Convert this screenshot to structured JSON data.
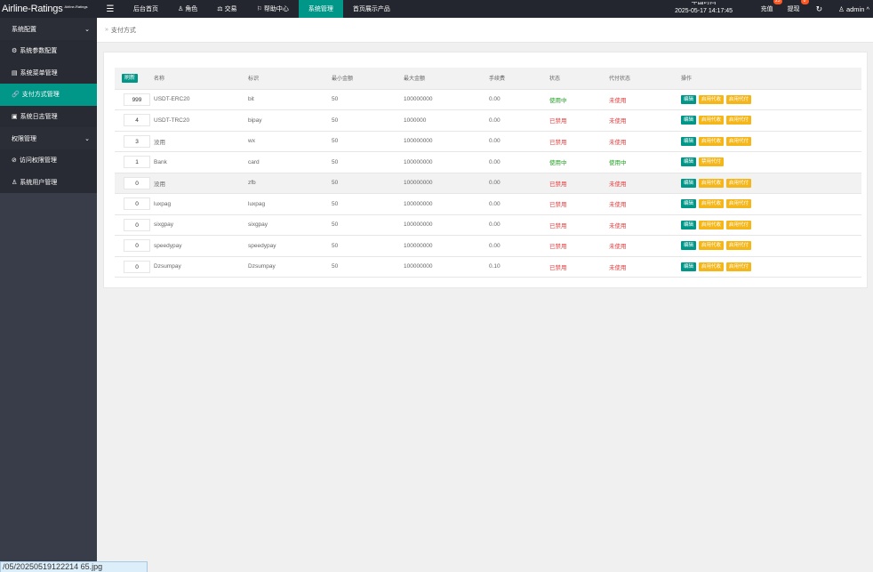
{
  "header": {
    "logo": "Airline-Ratings",
    "logo_sub": "Airline-Ratings",
    "menu_icon": "hamburger-icon",
    "nav": [
      {
        "label": "后台首页",
        "icon": ""
      },
      {
        "label": "角色",
        "icon": "user-icon"
      },
      {
        "label": "交易",
        "icon": "scale-icon"
      },
      {
        "label": "帮助中心",
        "icon": "flag-icon"
      },
      {
        "label": "系统管理",
        "icon": "",
        "active": true
      },
      {
        "label": "首页展示产品",
        "icon": ""
      }
    ],
    "time_label": "中国时间",
    "time_value": "2025-05-17 14:17:45",
    "recharge_label": "充值",
    "recharge_badge": "23",
    "withdraw_label": "提现",
    "withdraw_badge": "0",
    "admin_label": "admin",
    "accent": "#009688"
  },
  "sidebar": {
    "groups": [
      {
        "label": "系统配置",
        "items": [
          {
            "label": "系统参数配置",
            "icon": "gear-icon"
          },
          {
            "label": "系统菜单管理",
            "icon": "list-icon"
          },
          {
            "label": "支付方式管理",
            "icon": "link-icon",
            "active": true
          },
          {
            "label": "系统日志管理",
            "icon": "document-icon"
          }
        ]
      },
      {
        "label": "权限管理",
        "items": [
          {
            "label": "访问权限管理",
            "icon": "shield-check-icon"
          },
          {
            "label": "系统用户管理",
            "icon": "user-icon"
          }
        ]
      }
    ]
  },
  "breadcrumb": "支付方式",
  "tooltip": "/05/20250519122214 65.jpg",
  "table": {
    "refresh_label": "刷新",
    "headers": [
      "名称",
      "标识",
      "最小金额",
      "最大金额",
      "手续费",
      "状态",
      "代付状态",
      "操作"
    ],
    "rows": [
      {
        "sort": "999",
        "name": "USDT-ERC20",
        "code": "bit",
        "min": "50",
        "max": "100000000",
        "fee": "0.00",
        "status": "使用中",
        "status_ok": true,
        "payout": "未使用",
        "payout_ok": false,
        "actions": [
          "编辑",
          "启用代收",
          "启用代付"
        ]
      },
      {
        "sort": "4",
        "name": "USDT-TRC20",
        "code": "bipay",
        "min": "50",
        "max": "1000000",
        "fee": "0.00",
        "status": "已禁用",
        "status_ok": false,
        "payout": "未使用",
        "payout_ok": false,
        "actions": [
          "编辑",
          "启用代收",
          "启用代付"
        ]
      },
      {
        "sort": "3",
        "name": "没用",
        "code": "wx",
        "min": "50",
        "max": "100000000",
        "fee": "0.00",
        "status": "已禁用",
        "status_ok": false,
        "payout": "未使用",
        "payout_ok": false,
        "actions": [
          "编辑",
          "启用代收",
          "启用代付"
        ]
      },
      {
        "sort": "1",
        "name": "Bank",
        "code": "card",
        "min": "50",
        "max": "100000000",
        "fee": "0.00",
        "status": "使用中",
        "status_ok": true,
        "payout": "使用中",
        "payout_ok": true,
        "actions": [
          "编辑",
          "禁用代付"
        ]
      },
      {
        "sort": "0",
        "name": "没用",
        "code": "zfb",
        "min": "50",
        "max": "100000000",
        "fee": "0.00",
        "status": "已禁用",
        "status_ok": false,
        "payout": "未使用",
        "payout_ok": false,
        "actions": [
          "编辑",
          "启用代收",
          "启用代付"
        ],
        "highlight": true
      },
      {
        "sort": "0",
        "name": "luxpag",
        "code": "luxpag",
        "min": "50",
        "max": "100000000",
        "fee": "0.00",
        "status": "已禁用",
        "status_ok": false,
        "payout": "未使用",
        "payout_ok": false,
        "actions": [
          "编辑",
          "启用代收",
          "启用代付"
        ]
      },
      {
        "sort": "0",
        "name": "sixgpay",
        "code": "sixgpay",
        "min": "50",
        "max": "100000000",
        "fee": "0.00",
        "status": "已禁用",
        "status_ok": false,
        "payout": "未使用",
        "payout_ok": false,
        "actions": [
          "编辑",
          "启用代收",
          "启用代付"
        ]
      },
      {
        "sort": "0",
        "name": "speedypay",
        "code": "speedypay",
        "min": "50",
        "max": "100000000",
        "fee": "0.00",
        "status": "已禁用",
        "status_ok": false,
        "payout": "未使用",
        "payout_ok": false,
        "actions": [
          "编辑",
          "启用代收",
          "启用代付"
        ]
      },
      {
        "sort": "0",
        "name": "Dzsumpay",
        "code": "Dzsumpay",
        "min": "50",
        "max": "100000000",
        "fee": "0.10",
        "status": "已禁用",
        "status_ok": false,
        "payout": "未使用",
        "payout_ok": false,
        "actions": [
          "编辑",
          "启用代收",
          "启用代付"
        ]
      }
    ]
  }
}
